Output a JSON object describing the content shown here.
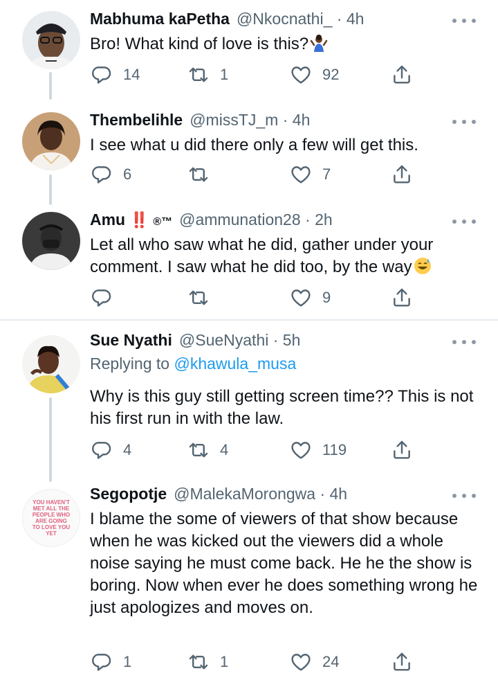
{
  "tweets": [
    {
      "name": "Mabhuma kaPetha",
      "handle": "@Nkocnathi_",
      "time": "4h",
      "text": "Bro! What kind of love is this?",
      "replies": "14",
      "retweets": "1",
      "likes": "92"
    },
    {
      "name": "Thembelihle",
      "handle": "@missTJ_m",
      "time": "4h",
      "text": "I see what u did there only a few will get this.",
      "replies": "6",
      "retweets": "",
      "likes": "7"
    },
    {
      "name": "Amu",
      "name_badge_1": "‼️",
      "name_badge_2": "®™",
      "handle": "@ammunation28",
      "time": "2h",
      "text": "Let all who saw what he did, gather under your comment. I saw what he did too, by the way",
      "replies": "",
      "retweets": "",
      "likes": "9"
    },
    {
      "name": "Sue Nyathi",
      "handle": "@SueNyathi",
      "time": "5h",
      "replying_prefix": "Replying to",
      "replying_handle": "@khawula_musa",
      "text": "Why is this guy still getting screen time?? This is not his first run in with the law.",
      "replies": "4",
      "retweets": "4",
      "likes": "119"
    },
    {
      "name": "Segopotje",
      "handle": "@MalekaMorongwa",
      "time": "4h",
      "avatar_text": "YOU HAVEN'T MET ALL THE PEOPLE WHO ARE GOING TO LOVE YOU YET",
      "text": "I blame the some of viewers of that show because when he was kicked out the viewers did a whole noise saying he must come back. He he the show is boring. Now when ever he does something wrong he just apologizes and moves on.",
      "replies": "1",
      "retweets": "1",
      "likes": "24"
    }
  ],
  "separator": "·",
  "colors": {
    "text": "#0f1419",
    "secondary": "#536471",
    "link": "#1d9bf0",
    "thread_line": "#cfd9de",
    "divider": "#e6ecf0"
  },
  "icons": [
    "reply-icon",
    "retweet-icon",
    "like-icon",
    "share-icon",
    "more-icon",
    "shrug-emoji",
    "sweat-smile-emoji"
  ]
}
